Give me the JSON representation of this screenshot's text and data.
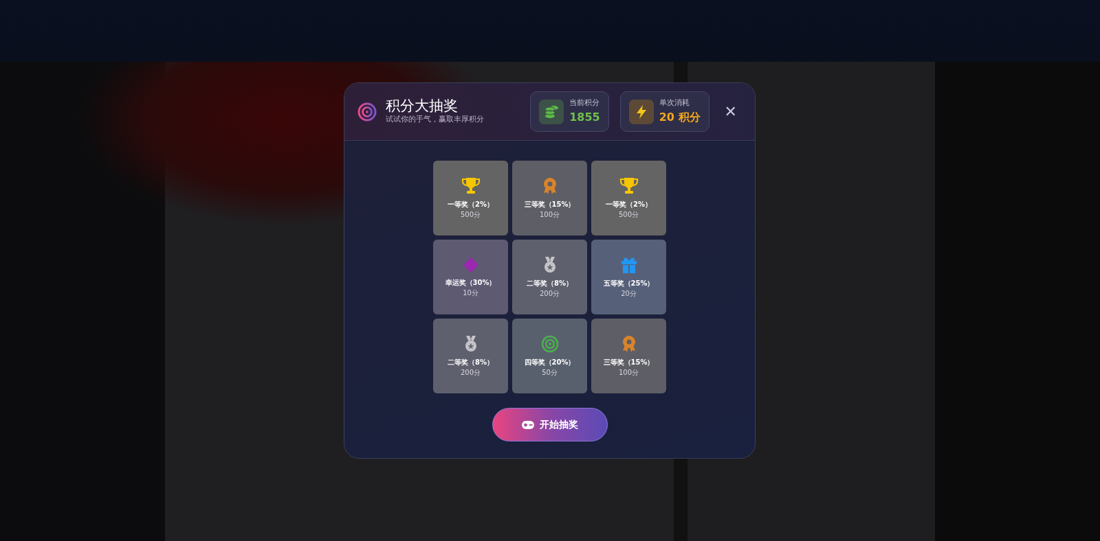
{
  "modal": {
    "title": "积分大抽奖",
    "subtitle": "试试你的手气，赢取丰厚积分",
    "stats": [
      {
        "kind": "coins",
        "label": "当前积分",
        "value": "1855"
      },
      {
        "kind": "bolt",
        "label": "单次消耗",
        "value": "20 积分"
      }
    ],
    "close": "✕"
  },
  "prizes": [
    {
      "kind": "trophy",
      "name": "一等奖（2%）",
      "points": "500分"
    },
    {
      "kind": "bronze",
      "name": "三等奖（15%）",
      "points": "100分"
    },
    {
      "kind": "trophy",
      "name": "一等奖（2%）",
      "points": "500分"
    },
    {
      "kind": "clover",
      "name": "幸运奖（30%）",
      "points": "10分"
    },
    {
      "kind": "silver",
      "name": "二等奖（8%）",
      "points": "200分"
    },
    {
      "kind": "gift",
      "name": "五等奖（25%）",
      "points": "20分"
    },
    {
      "kind": "silver",
      "name": "二等奖（8%）",
      "points": "200分"
    },
    {
      "kind": "target",
      "name": "四等奖（20%）",
      "points": "50分"
    },
    {
      "kind": "bronze",
      "name": "三等奖（15%）",
      "points": "100分"
    }
  ],
  "start_button": "开始抽奖"
}
